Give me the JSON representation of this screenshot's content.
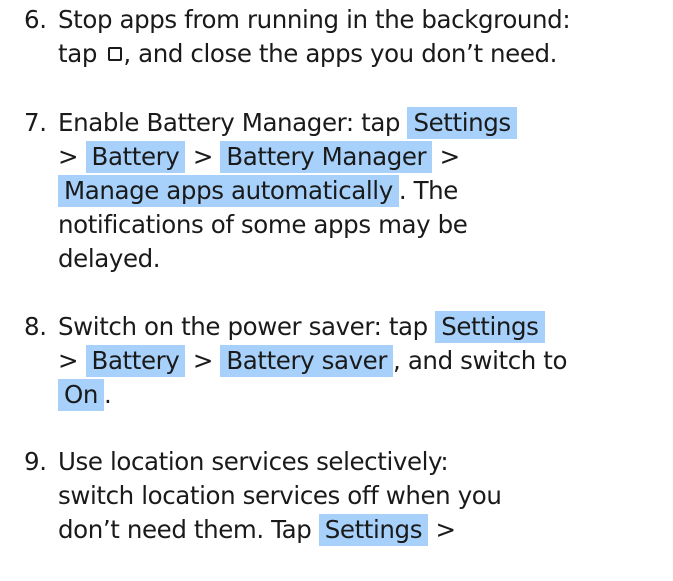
{
  "items": [
    {
      "number": "6.",
      "lines": [
        "Stop apps from running in the background:",
        [
          "tap",
          "",
          ", and close the apps you don’t need."
        ]
      ],
      "icon": "recent-apps-square-icon"
    },
    {
      "number": "7.",
      "intro": "Enable Battery Manager: tap",
      "path1": "Settings",
      "path2": "Battery",
      "path3": "Battery Manager",
      "path4": "Manage apps automatically",
      "tail1": ". The",
      "tail2": "notifications of some apps may be",
      "tail3": "delayed.",
      "sep": ">"
    },
    {
      "number": "8.",
      "intro": "Switch on the power saver: tap",
      "path1": "Settings",
      "path2": "Battery",
      "path3": "Battery saver",
      "mid": ", and switch to",
      "path4": "On",
      "tail": ".",
      "sep": ">"
    },
    {
      "number": "9.",
      "line1": "Use location services selectively:",
      "line2": "switch location services off when you",
      "line3a": "don’t need them. Tap",
      "path1": "Settings",
      "sep": ">"
    }
  ],
  "item6": {
    "line1": "Stop apps from running in the background:",
    "line2a": "tap",
    "line2b": ", and close the apps you don’t need."
  },
  "colors": {
    "highlight": "#a7d1fb",
    "text": "#1a1a1a"
  }
}
